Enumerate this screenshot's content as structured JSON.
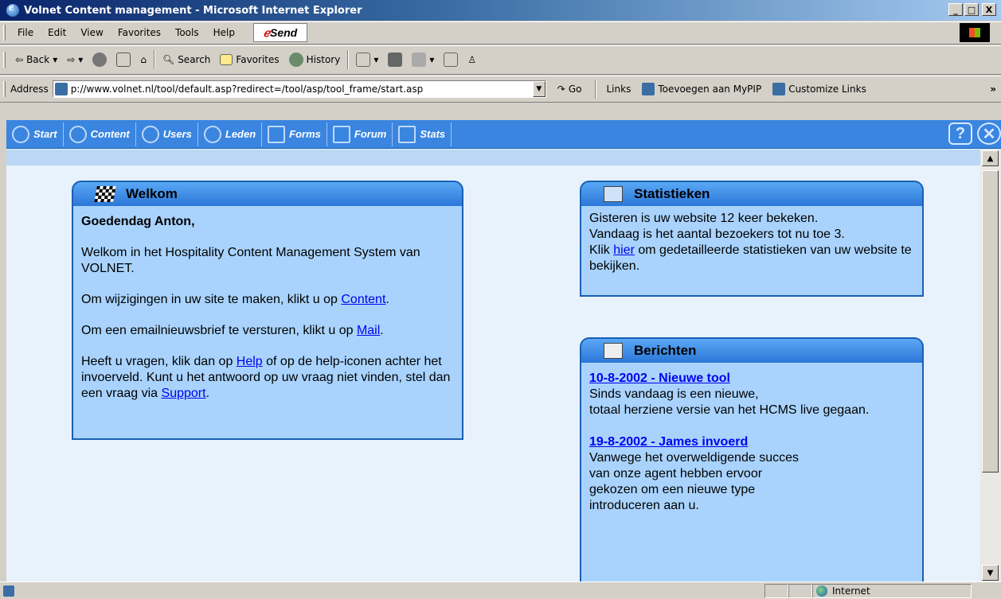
{
  "window": {
    "title": "Volnet Content management - Microsoft Internet Explorer",
    "buttons": [
      "_",
      "□",
      "X"
    ]
  },
  "menu": {
    "items": [
      "File",
      "Edit",
      "View",
      "Favorites",
      "Tools",
      "Help"
    ],
    "send": "Send"
  },
  "toolbar": {
    "back": "Back",
    "search": "Search",
    "favorites": "Favorites",
    "history": "History"
  },
  "address": {
    "label": "Address",
    "url": "p://www.volnet.nl/tool/default.asp?redirect=/tool/asp/tool_frame/start.asp",
    "go": "Go",
    "links_label": "Links",
    "links": [
      "Toevoegen aan MyPIP",
      "Customize Links"
    ]
  },
  "app_nav": {
    "items": [
      "Start",
      "Content",
      "Users",
      "Leden",
      "Forms",
      "Forum",
      "Stats"
    ]
  },
  "welkom": {
    "title": "Welkom",
    "greeting": "Goedendag Anton,",
    "intro": "Welkom in het Hospitality Content Management System van VOLNET.",
    "content_pre": "Om wijzigingen in uw site te maken, klikt u op ",
    "content_link": "Content",
    "mail_pre": "Om een emailnieuwsbrief te versturen, klikt u op ",
    "mail_link": "Mail",
    "help_pre": "Heeft u vragen, klik dan op ",
    "help_link": "Help",
    "help_post": " of op de help-iconen achter het invoerveld. Kunt u het antwoord op uw vraag niet vinden, stel dan een vraag via ",
    "support_link": "Support"
  },
  "stats": {
    "title": "Statistieken",
    "line1": "Gisteren is uw website 12 keer bekeken.",
    "line2": "Vandaag is het aantal bezoekers tot nu toe 3.",
    "klik": "Klik ",
    "hier": "hier",
    "rest": " om gedetailleerde statistieken van uw website te bekijken."
  },
  "berichten": {
    "title": "Berichten",
    "items": [
      {
        "heading": "10-8-2002 - Nieuwe tool",
        "lines": [
          "Sinds vandaag is een nieuwe,",
          "totaal herziene versie van het HCMS live gegaan."
        ]
      },
      {
        "heading": "19-8-2002 - James invoerd",
        "lines": [
          "Vanwege het overweldigende succes",
          "van onze agent hebben ervoor",
          "gekozen om een nieuwe type",
          "introduceren aan u."
        ]
      }
    ]
  },
  "status": {
    "zone": "Internet"
  }
}
